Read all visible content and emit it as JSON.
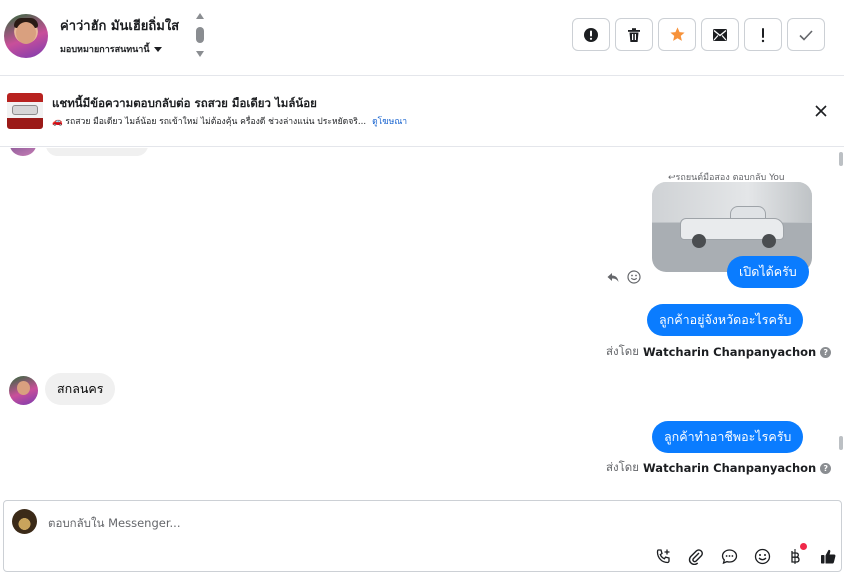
{
  "header": {
    "contact_name": "ค่าว่าฮัก มันเฮียถิ่มใส",
    "assign_label": "มอบหมายการสนทนานี้",
    "actions": [
      {
        "name": "spam-button",
        "icon": "alert-circle-icon"
      },
      {
        "name": "delete-button",
        "icon": "trash-icon"
      },
      {
        "name": "star-button",
        "icon": "star-icon"
      },
      {
        "name": "mark-unread-button",
        "icon": "envelope-icon"
      },
      {
        "name": "follow-up-button",
        "icon": "exclamation-icon"
      },
      {
        "name": "mark-done-button",
        "icon": "check-icon"
      }
    ]
  },
  "ad": {
    "title": "แชทนี้มีข้อความตอบกลับต่อ รถสวย มือเดียว ไมล์น้อย",
    "description": "🚗 รถสวย มือเดียว ไมล์น้อย รถเข้าใหม่ ไม่ต้องคุ้น ครื่องดี ช่วงล่างแน่น ประหยัดจริ...",
    "link": "ดูโฆษณา"
  },
  "messages": {
    "reply_note": "↩รถยนต์มือสอง ตอบกลับ You",
    "bubble_1": "เปิดได้ครับ",
    "bubble_2": "ลูกค้าอยู่จังหวัดอะไรครับ",
    "sent_by_label": "ส่งโดย",
    "sender": "Watcharin Chanpanyachon",
    "incoming_1": "สกลนคร",
    "bubble_3": "ลูกค้าทำอาชีพอะไรครับ"
  },
  "composer": {
    "placeholder": "ตอบกลับใน Messenger..."
  },
  "colors": {
    "brand_blue": "#0a7cff",
    "star_orange": "#f7923a",
    "link_blue": "#1763cf"
  }
}
